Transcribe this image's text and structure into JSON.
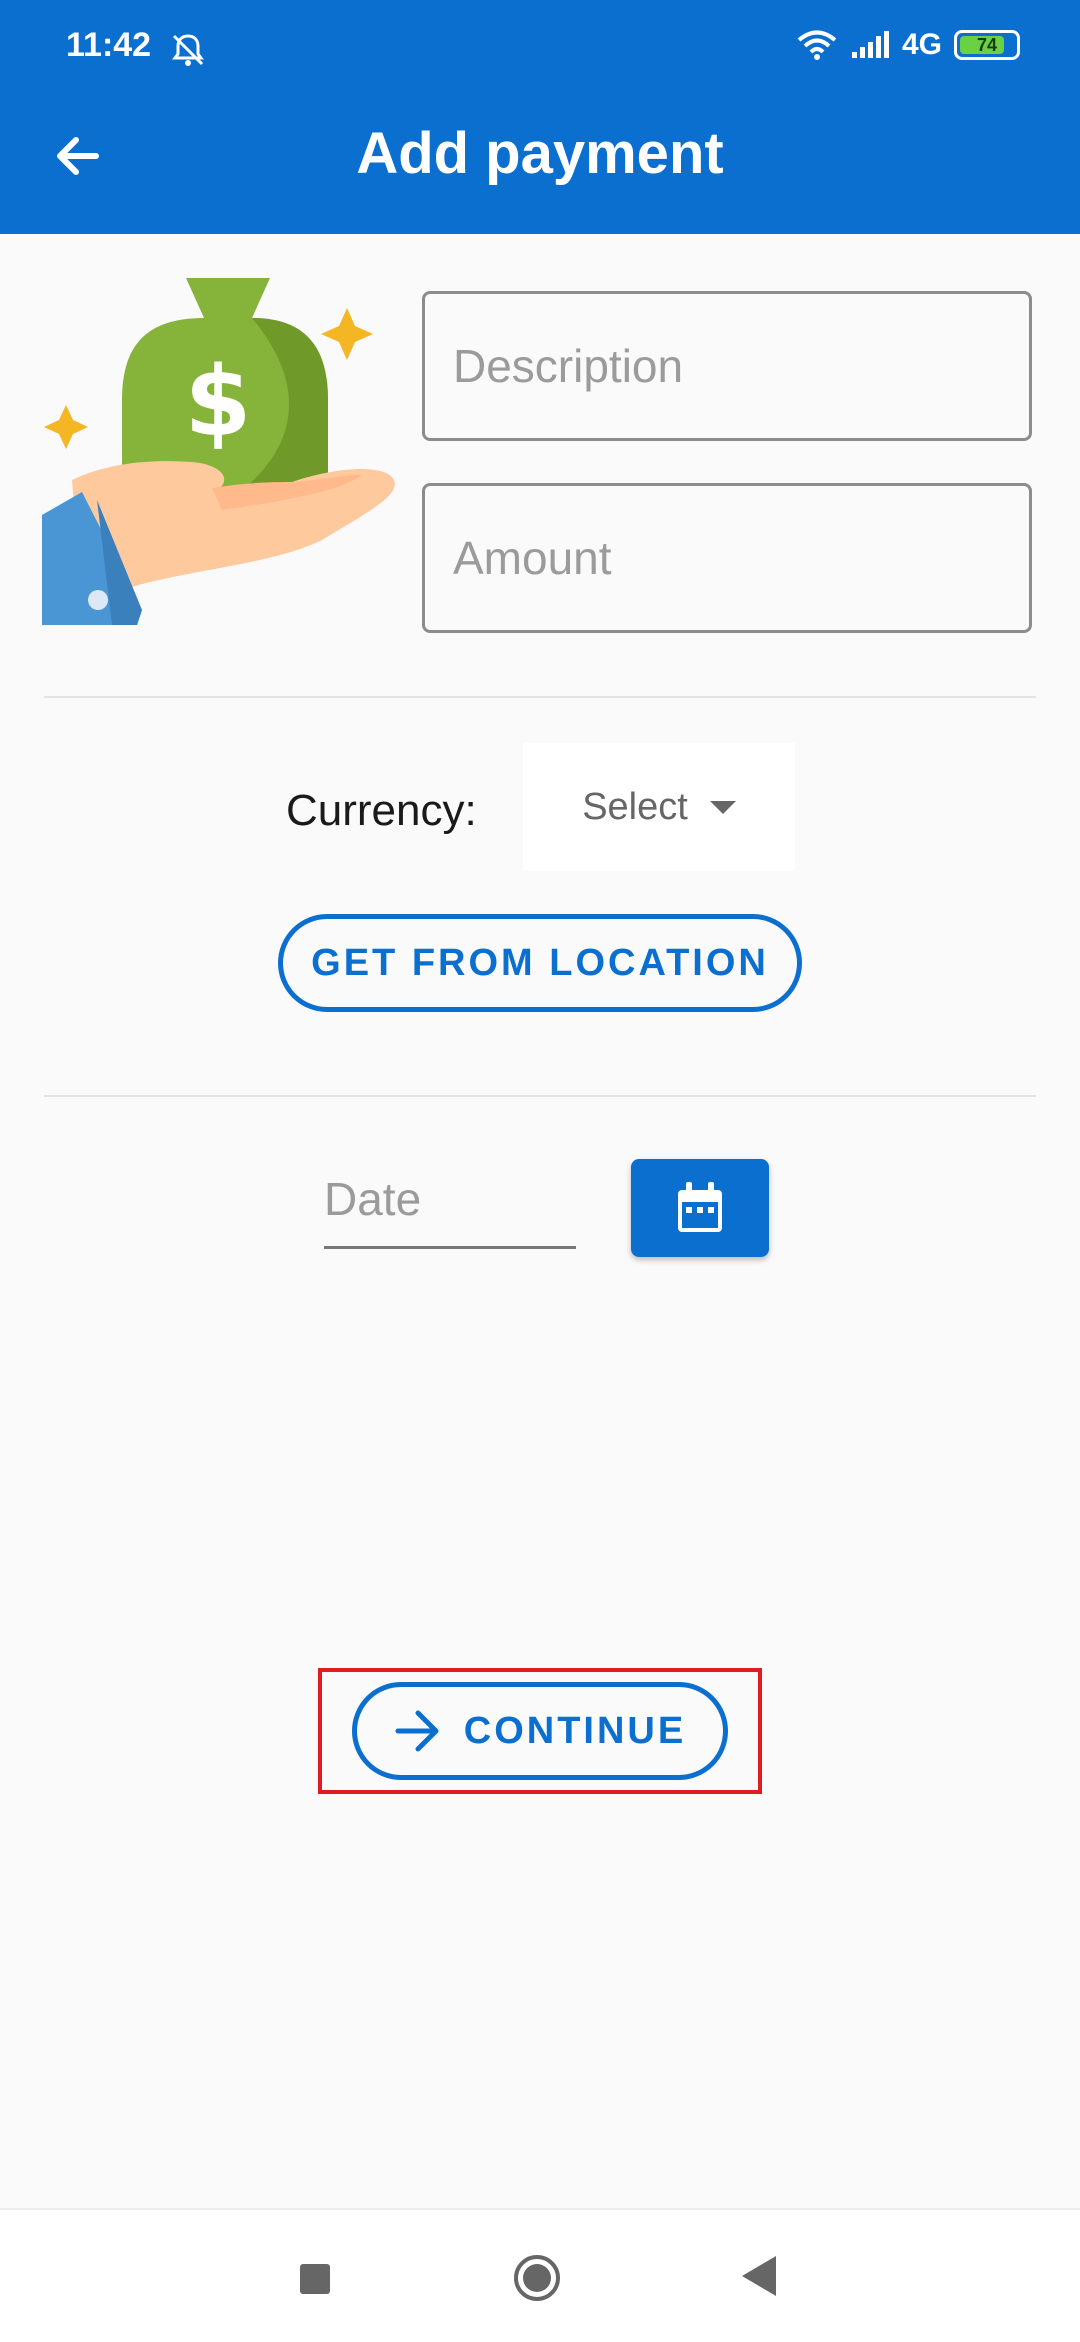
{
  "status_bar": {
    "time": "11:42",
    "network": "4G",
    "battery": "74",
    "battery_level_pct": 74
  },
  "header": {
    "title": "Add payment"
  },
  "form": {
    "description_placeholder": "Description",
    "amount_placeholder": "Amount",
    "currency_label": "Currency:",
    "currency_selected": "Select",
    "location_button": "GET FROM LOCATION",
    "date_placeholder": "Date",
    "continue_button": "CONTINUE"
  },
  "colors": {
    "primary": "#0a6fcf",
    "highlight": "#e11b22",
    "background": "#fafafa"
  }
}
